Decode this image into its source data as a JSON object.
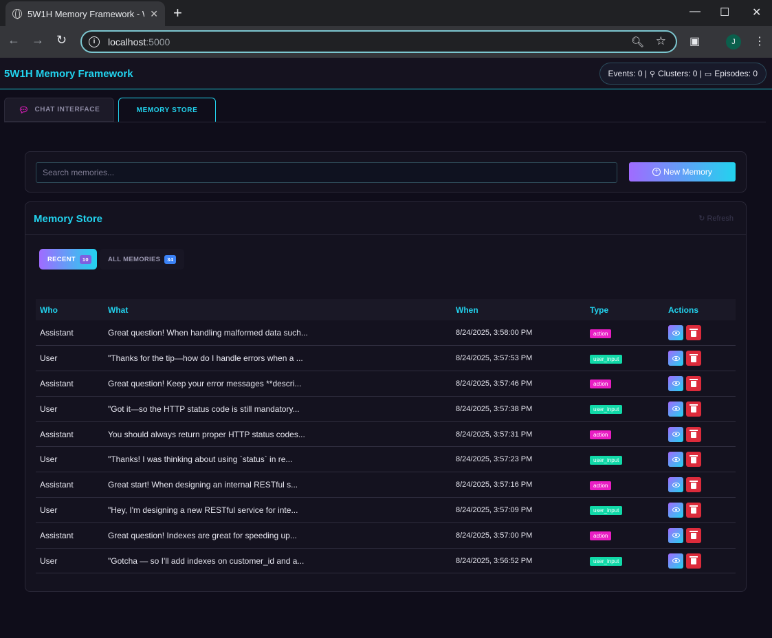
{
  "browser": {
    "tab_title": "5W1H Memory Framework - W",
    "url_host": "localhost",
    "url_port": ":5000"
  },
  "header": {
    "brand": "5W1H Memory Framework",
    "stats_events": "Events: 0 |",
    "stats_clusters": "Clusters: 0 |",
    "stats_episodes": "Episodes: 0"
  },
  "tabs": {
    "chat": "CHAT INTERFACE",
    "store": "MEMORY STORE"
  },
  "search": {
    "placeholder": "Search memories...",
    "new_button": "New Memory"
  },
  "store": {
    "title": "Memory Store",
    "refresh": "Refresh",
    "subtabs": {
      "recent": "RECENT",
      "recent_count": "10",
      "all": "ALL MEMORIES",
      "all_count": "34"
    },
    "columns": [
      "Who",
      "What",
      "When",
      "Type",
      "Actions"
    ],
    "rows": [
      {
        "who": "Assistant",
        "what": "Great question! When handling malformed data such...",
        "when": "8/24/2025, 3:58:00 PM",
        "type": "action"
      },
      {
        "who": "User",
        "what": "\"Thanks for the tip—how do I handle errors when a ...",
        "when": "8/24/2025, 3:57:53 PM",
        "type": "user_input"
      },
      {
        "who": "Assistant",
        "what": "Great question! Keep your error messages **descri...",
        "when": "8/24/2025, 3:57:46 PM",
        "type": "action"
      },
      {
        "who": "User",
        "what": "\"Got it—so the HTTP status code is still mandatory...",
        "when": "8/24/2025, 3:57:38 PM",
        "type": "user_input"
      },
      {
        "who": "Assistant",
        "what": "You should always return proper HTTP status codes...",
        "when": "8/24/2025, 3:57:31 PM",
        "type": "action"
      },
      {
        "who": "User",
        "what": "\"Thanks! I was thinking about using `status` in re...",
        "when": "8/24/2025, 3:57:23 PM",
        "type": "user_input"
      },
      {
        "who": "Assistant",
        "what": "Great start! When designing an internal RESTful s...",
        "when": "8/24/2025, 3:57:16 PM",
        "type": "action"
      },
      {
        "who": "User",
        "what": "\"Hey, I'm designing a new RESTful service for inte...",
        "when": "8/24/2025, 3:57:09 PM",
        "type": "user_input"
      },
      {
        "who": "Assistant",
        "what": "Great question! Indexes are great for speeding up...",
        "when": "8/24/2025, 3:57:00 PM",
        "type": "action"
      },
      {
        "who": "User",
        "what": "\"Gotcha — so I'll add indexes on customer_id and a...",
        "when": "8/24/2025, 3:56:52 PM",
        "type": "user_input"
      }
    ]
  },
  "colors": {
    "accent": "#22d3ee",
    "action_badge": "#e91ec4",
    "user_input_badge": "#11d9a8",
    "delete": "#dc2b3b"
  }
}
